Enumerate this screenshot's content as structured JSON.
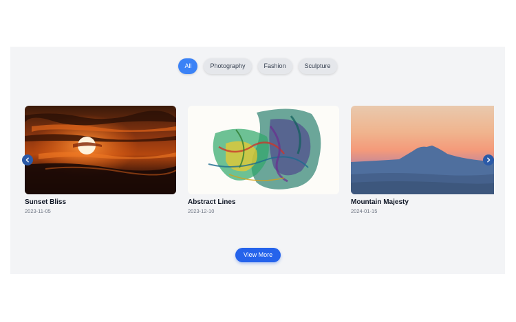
{
  "filters": {
    "items": [
      {
        "label": "All",
        "active": true
      },
      {
        "label": "Photography",
        "active": false
      },
      {
        "label": "Fashion",
        "active": false
      },
      {
        "label": "Sculpture",
        "active": false
      }
    ]
  },
  "gallery": {
    "items": [
      {
        "title": "Sunset Bliss",
        "date": "2023-11-05",
        "image": "sunset-photo"
      },
      {
        "title": "Abstract Lines",
        "date": "2023-12-10",
        "image": "abstract-painting"
      },
      {
        "title": "Mountain Majesty",
        "date": "2024-01-15",
        "image": "mountain-photo"
      }
    ]
  },
  "carousel": {
    "prev_icon": "chevron-left-icon",
    "next_icon": "chevron-right-icon"
  },
  "actions": {
    "view_more_label": "View More"
  },
  "colors": {
    "section_bg": "#f3f4f6",
    "accent": "#3b82f6",
    "button": "#2563eb",
    "chip_bg": "#e5e7eb",
    "arrow_bg": "#2b5aa8"
  }
}
